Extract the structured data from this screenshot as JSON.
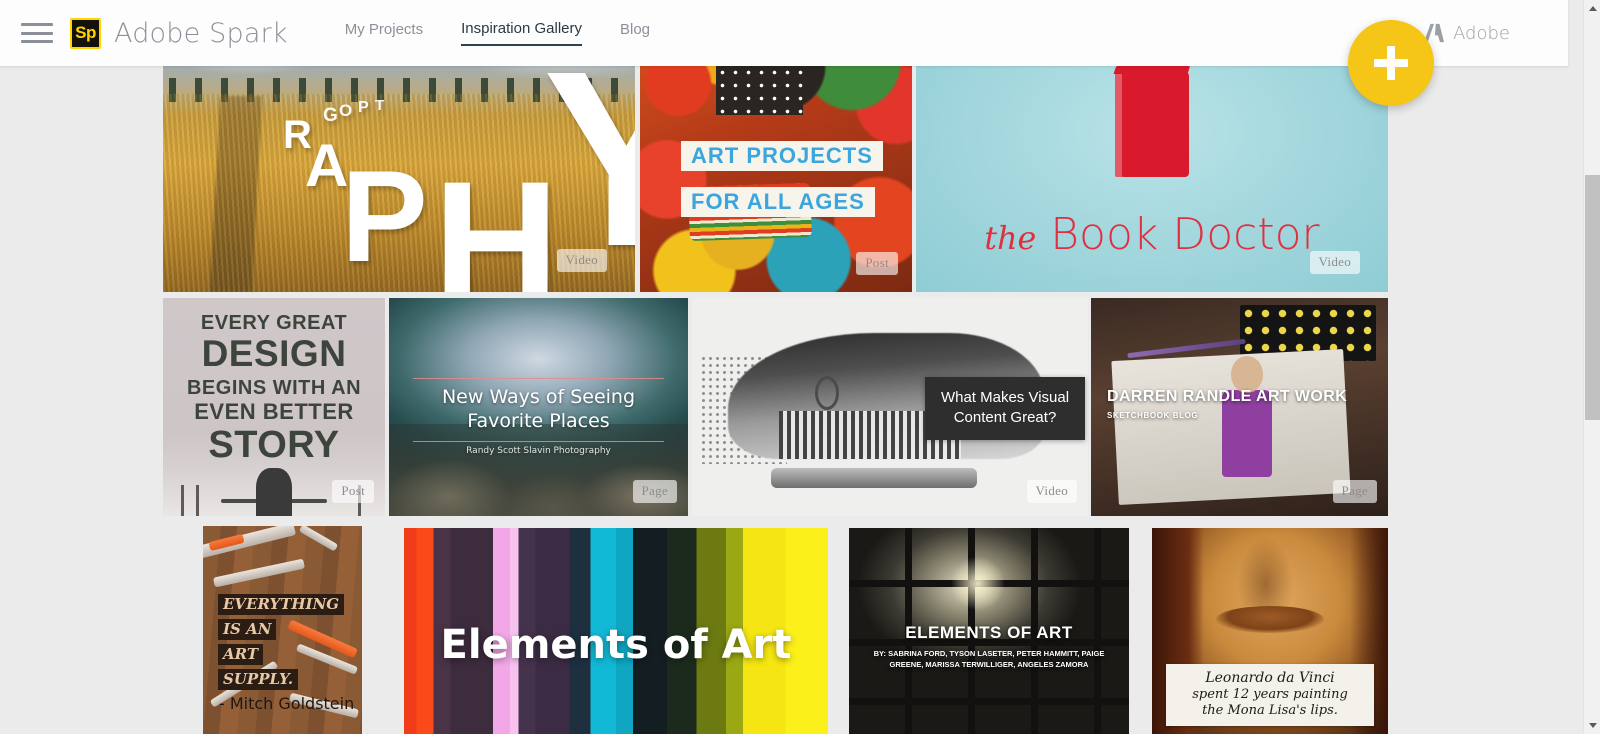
{
  "nav": {
    "menu_icon": "hamburger-icon",
    "logo_text": "Sp",
    "brand": "Adobe Spark",
    "links": [
      {
        "label": "My Projects",
        "active": false
      },
      {
        "label": "Inspiration Gallery",
        "active": true
      },
      {
        "label": "Blog",
        "active": false
      }
    ],
    "adobe_label": "Adobe",
    "adobe_icon": "adobe-logo-icon"
  },
  "fab": {
    "icon": "plus-icon",
    "label": "+"
  },
  "tooltip": {
    "text": "What Makes Visual Content Great?"
  },
  "scrollbar": {
    "up_icon": "caret-up-icon",
    "down_icon": "caret-down-icon"
  },
  "badges": {
    "video": "Video",
    "post": "Post",
    "page": "Page"
  },
  "gallery": {
    "cards": [
      {
        "id": "photography",
        "title_letters": [
          "R",
          "A",
          "P",
          "H",
          "Y"
        ],
        "title_small": [
          "G",
          "O",
          "P",
          "T"
        ],
        "full_title": "PHOTOGRAPHY",
        "badge": "Video"
      },
      {
        "id": "art-projects",
        "line1": "ART PROJECTS",
        "line2": "FOR ALL AGES",
        "badge": "Post"
      },
      {
        "id": "book-doctor",
        "title_prefix": "the",
        "title": "Book Doctor",
        "icon": "book-icon",
        "badge": "Video"
      },
      {
        "id": "every-great-design",
        "lines": [
          "EVERY GREAT",
          "DESIGN",
          "BEGINS WITH AN",
          "EVEN BETTER",
          "STORY"
        ],
        "badge": "Post"
      },
      {
        "id": "new-ways-seeing",
        "title": "New Ways of Seeing Favorite Places",
        "credit": "Randy Scott Slavin Photography",
        "badge": "Page"
      },
      {
        "id": "visual-content",
        "title": "What Makes Visual Content Great?",
        "badge": "Video"
      },
      {
        "id": "darren-randle",
        "title": "DARREN RANDLE ART WORK",
        "subtitle": "SKETCHBOOK BLOG",
        "badge": "Page"
      },
      {
        "id": "art-supply",
        "lines": [
          "EVERYTHING",
          "IS AN",
          "ART",
          "SUPPLY."
        ],
        "attribution": "- Mitch Goldstein",
        "badge": ""
      },
      {
        "id": "elements-of-art-pencils",
        "title": "Elements of Art",
        "badge": ""
      },
      {
        "id": "elements-of-art-windows",
        "title": "ELEMENTS OF ART",
        "credits": "BY: SABRINA FORD, TYSON LASETER, PETER HAMMITT, PAIGE GREENE, MARISSA TERWILLIGER, ANGELES ZAMORA",
        "badge": ""
      },
      {
        "id": "mona-lisa",
        "lines": [
          "Leonardo da Vinci",
          "spent 12 years painting",
          "the Mona Lisa's lips."
        ],
        "badge": ""
      }
    ]
  },
  "colors": {
    "accent_yellow": "#f5c518",
    "logo_yellow": "#ffd400",
    "page_bg": "#ebebeb",
    "nav_bg": "#fdfdfd",
    "nav_text": "#8c9199",
    "nav_active": "#2b3a44",
    "tooltip_bg": "#2e2e2e"
  }
}
